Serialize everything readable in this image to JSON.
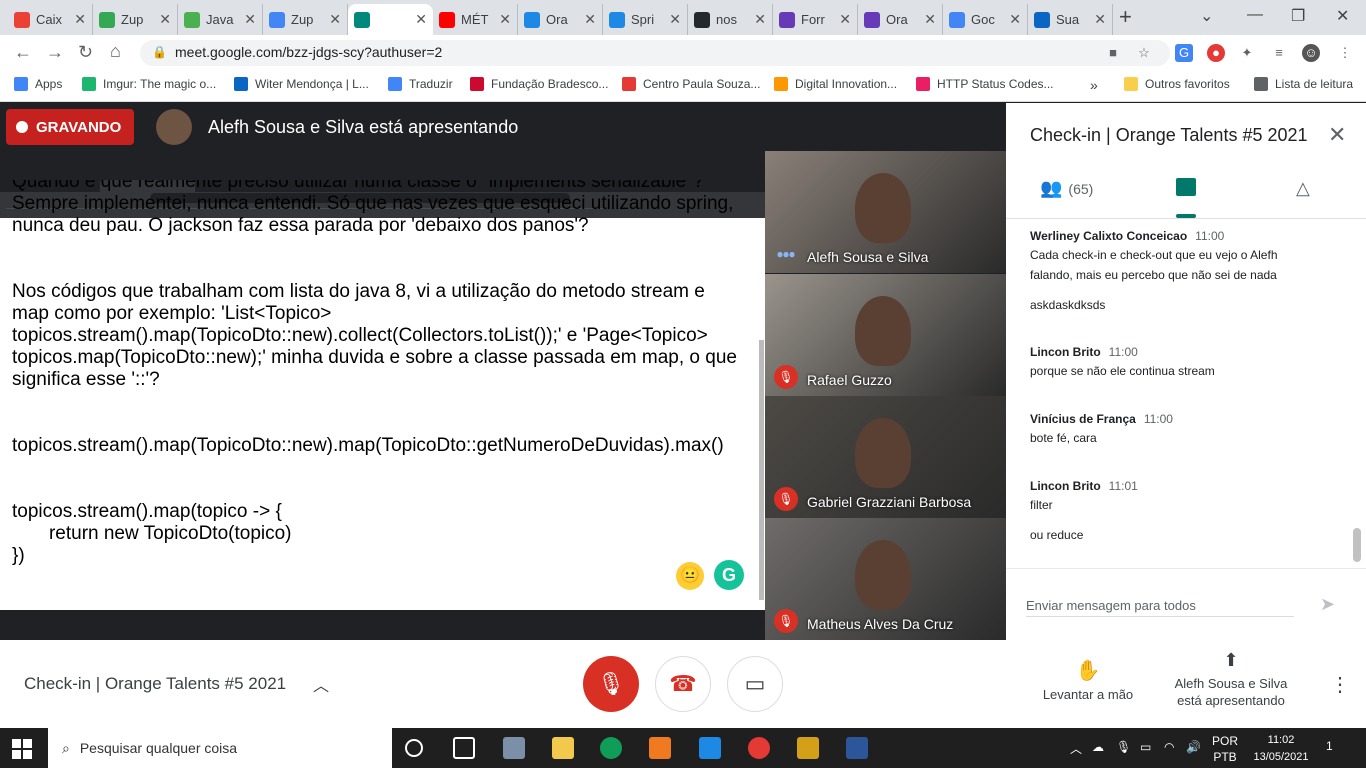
{
  "tabs": [
    {
      "label": "Caix",
      "color": "#ea4335"
    },
    {
      "label": "Zup",
      "color": "#34a853"
    },
    {
      "label": "Java",
      "color": "#4caf50"
    },
    {
      "label": "Zup",
      "color": "#4285f4"
    },
    {
      "label": "",
      "color": "#00897b"
    },
    {
      "label": "MÉT",
      "color": "#ff0000"
    },
    {
      "label": "Ora",
      "color": "#1e88e5"
    },
    {
      "label": "Spri",
      "color": "#1e88e5"
    },
    {
      "label": "nos",
      "color": "#24292e"
    },
    {
      "label": "Forr",
      "color": "#673ab7"
    },
    {
      "label": "Ora",
      "color": "#673ab7"
    },
    {
      "label": "Goc",
      "color": "#4285f4"
    },
    {
      "label": "Sua",
      "color": "#0a66c2"
    }
  ],
  "url": "meet.google.com/bzz-jdgs-scy?authuser=2",
  "bookmarks": [
    {
      "label": "Apps",
      "color": "#4285f4"
    },
    {
      "label": "Imgur: The magic o...",
      "color": "#1bb76e"
    },
    {
      "label": "Witer Mendonça | L...",
      "color": "#0a66c2"
    },
    {
      "label": "Traduzir",
      "color": "#4285f4"
    },
    {
      "label": "Fundação Bradesco...",
      "color": "#cc092f"
    },
    {
      "label": "Centro Paula Souza...",
      "color": "#e53935"
    },
    {
      "label": "Digital Innovation...",
      "color": "#ff9800"
    },
    {
      "label": "HTTP Status Codes...",
      "color": "#e91e63"
    },
    {
      "label": "Outros favoritos",
      "color": "#f9ce4b"
    },
    {
      "label": "Lista de leitura",
      "color": "#5f6368"
    }
  ],
  "recording_label": "GRAVANDO",
  "presenting_text": "Alefh Sousa e Silva está apresentando",
  "shared_screen": {
    "lines": [
      "Quando é que realmente preciso utilizar numa classe o \"implements serializable\"?",
      "Sempre implementei, nunca entendi. Só que nas vezes que esqueci utilizando spring,",
      "nunca deu pau. O jackson faz essa parada por 'debaixo dos panos'?",
      "",
      "",
      "Nos códigos que trabalham com lista do java 8, vi a utilização do metodo stream e",
      "map como por exemplo: 'List<Topico>",
      "topicos.stream().map(TopicoDto::new).collect(Collectors.toList());' e 'Page<Topico>",
      "topicos.map(TopicoDto::new);' minha duvida e sobre a classe passada em map, o que",
      "significa esse '::'?",
      "",
      "",
      "topicos.stream().map(TopicoDto::new).map(TopicoDto::getNumeroDeDuvidas).max()",
      "",
      "",
      "topicos.stream().map(topico -> {",
      "       return new TopicoDto(topico)",
      "})"
    ]
  },
  "participants": [
    {
      "name": "Alefh Sousa e Silva",
      "muted": false,
      "bg": "#8a8078"
    },
    {
      "name": "Rafael Guzzo",
      "muted": true,
      "bg": "#9a948c"
    },
    {
      "name": "Gabriel Grazziani Barbosa",
      "muted": true,
      "bg": "#4d4a45"
    },
    {
      "name": "Matheus Alves Da Cruz",
      "muted": true,
      "bg": "#6f6c6a"
    }
  ],
  "panel": {
    "title": "Check-in | Orange Talents #5 2021",
    "people_count": "(65)",
    "messages": [
      {
        "author": "Werliney Calixto Conceicao",
        "time": "11:00",
        "texts": [
          "Cada check-in e check-out que eu vejo o Alefh",
          "falando, mais eu percebo que não sei de nada",
          "askdaskdksds"
        ]
      },
      {
        "author": "Lincon Brito",
        "time": "11:00",
        "texts": [
          "porque se não ele continua stream"
        ]
      },
      {
        "author": "Vinícius de França",
        "time": "11:00",
        "texts": [
          "bote fé, cara"
        ]
      },
      {
        "author": "Lincon Brito",
        "time": "11:01",
        "texts": [
          "filter",
          "ou reduce"
        ]
      }
    ],
    "input_placeholder": "Enviar mensagem para todos"
  },
  "bottom": {
    "meeting_title": "Check-in | Orange Talents #5 2021",
    "raise_hand": "Levantar a mão",
    "presenting_line1": "Alefh Sousa e Silva",
    "presenting_line2": "está apresentando"
  },
  "taskbar": {
    "search_placeholder": "Pesquisar qualquer coisa",
    "lang1": "POR",
    "lang2": "PTB",
    "time": "11:02",
    "date": "13/05/2021",
    "notifications": "1"
  }
}
